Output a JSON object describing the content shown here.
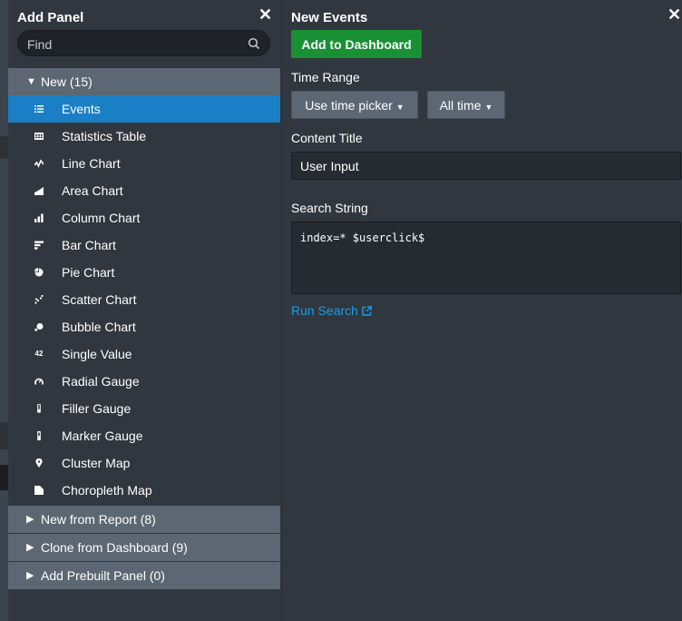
{
  "add_panel": {
    "title": "Add Panel",
    "search_placeholder": "Find",
    "groups": {
      "new": "New (15)",
      "new_from_report": "New from Report (8)",
      "clone_from_dashboard": "Clone from Dashboard (9)",
      "add_prebuilt": "Add Prebuilt Panel (0)"
    },
    "items": [
      {
        "label": "Events",
        "icon": "events-icon"
      },
      {
        "label": "Statistics Table",
        "icon": "table-icon"
      },
      {
        "label": "Line Chart",
        "icon": "line-chart-icon"
      },
      {
        "label": "Area Chart",
        "icon": "area-chart-icon"
      },
      {
        "label": "Column Chart",
        "icon": "column-chart-icon"
      },
      {
        "label": "Bar Chart",
        "icon": "bar-chart-icon"
      },
      {
        "label": "Pie Chart",
        "icon": "pie-chart-icon"
      },
      {
        "label": "Scatter Chart",
        "icon": "scatter-chart-icon"
      },
      {
        "label": "Bubble Chart",
        "icon": "bubble-chart-icon"
      },
      {
        "label": "Single Value",
        "icon": "single-value-icon",
        "glyph": "42"
      },
      {
        "label": "Radial Gauge",
        "icon": "radial-gauge-icon"
      },
      {
        "label": "Filler Gauge",
        "icon": "filler-gauge-icon"
      },
      {
        "label": "Marker Gauge",
        "icon": "marker-gauge-icon"
      },
      {
        "label": "Cluster Map",
        "icon": "map-pin-icon"
      },
      {
        "label": "Choropleth Map",
        "icon": "choropleth-map-icon"
      }
    ]
  },
  "new_events": {
    "title": "New Events",
    "add_button": "Add to Dashboard",
    "time_range_label": "Time Range",
    "time_picker_button": "Use time picker",
    "all_time_button": "All time",
    "content_title_label": "Content Title",
    "content_title_value": "User Input",
    "search_string_label": "Search String",
    "search_string_value": "index=* $userclick$",
    "run_search_link": "Run Search"
  },
  "colors": {
    "panel_bg": "#31373e",
    "group_header": "#5c6773",
    "active_item": "#1a7fc4",
    "primary_button": "#1a9035",
    "link": "#1a9ceb"
  }
}
